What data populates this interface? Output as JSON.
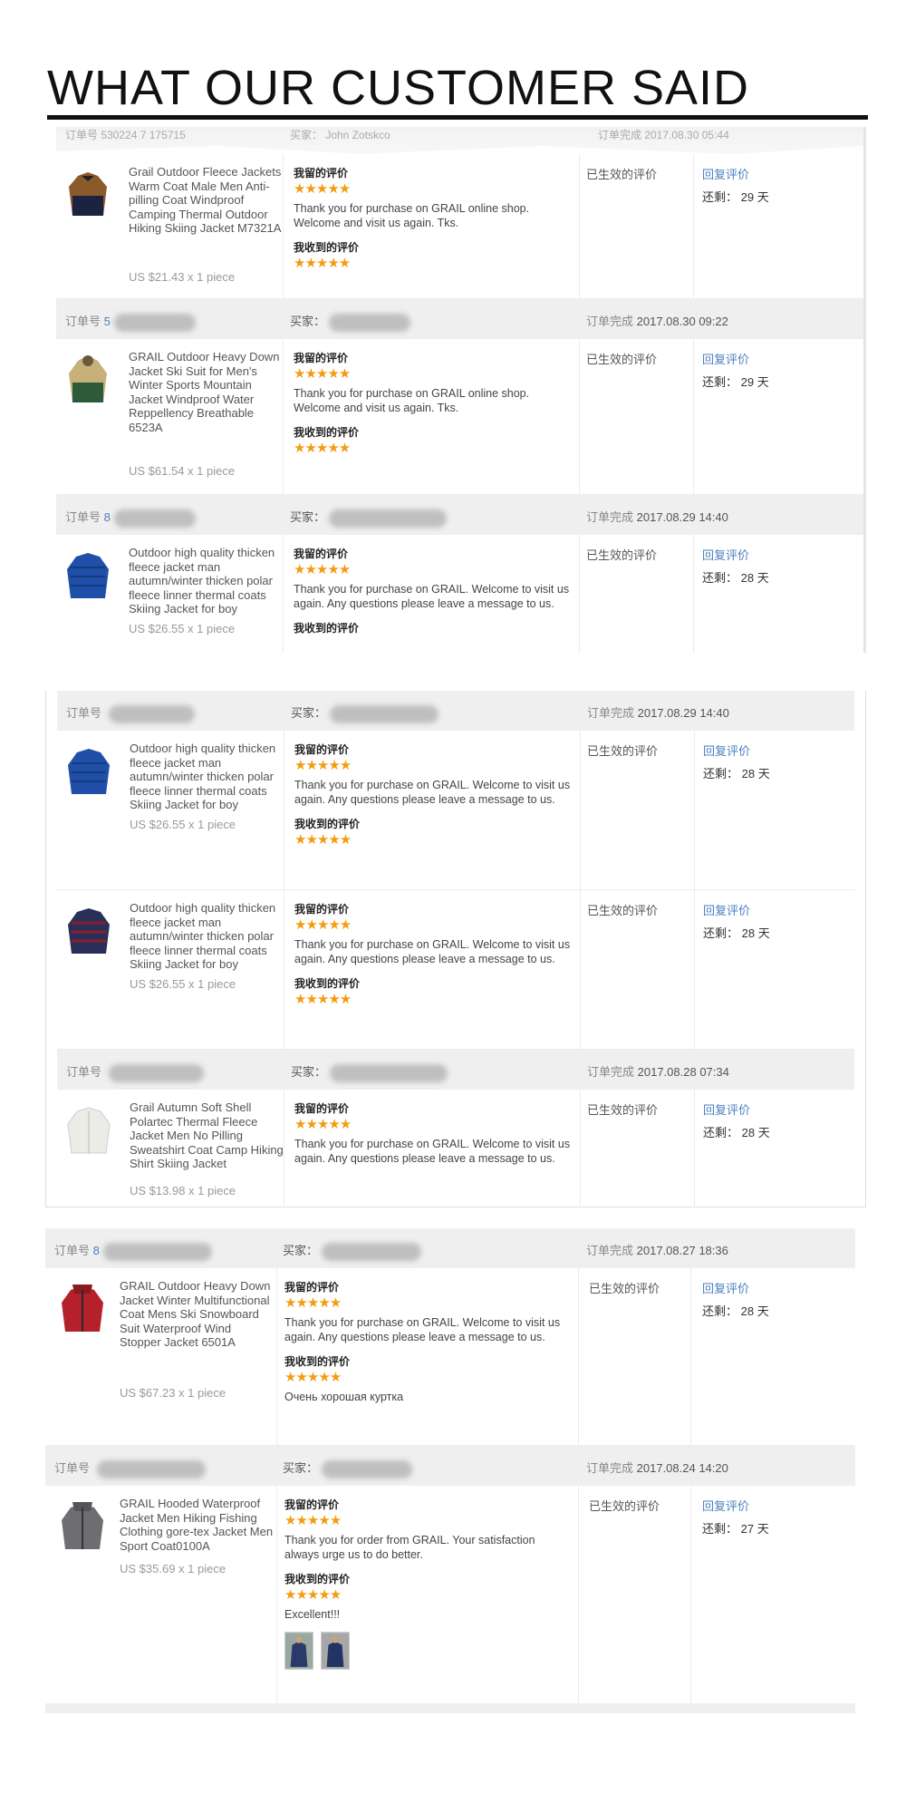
{
  "page_title": "WHAT OUR CUSTOMER SAID",
  "labels": {
    "order_no": "订单号",
    "buyer": "买家：",
    "order_done": "订单完成",
    "my_review": "我留的评价",
    "received_review": "我收到的评价",
    "effective": "已生效的评价",
    "reply": "回复评价",
    "remain_prefix": "还剩：",
    "days_suffix": "天"
  },
  "top_strip": {
    "order_no_partial": "订单号 530224 7 175715",
    "buyer_partial": "买家： John Zotskco",
    "done_partial": "订单完成 2017.08.30 05:44"
  },
  "orders": [
    {
      "done_time": "2017.08.30 09:22",
      "no_partial": "5"
    },
    {
      "done_time": "2017.08.29 14:40",
      "no_partial": "8"
    },
    {
      "done_time": "2017.08.29 14:40",
      "no_partial": ""
    },
    {
      "done_time": "2017.08.28 07:34",
      "no_partial": ""
    },
    {
      "done_time": "2017.08.27 18:36",
      "no_partial": "8"
    },
    {
      "done_time": "2017.08.24 14:20",
      "no_partial": ""
    }
  ],
  "items": [
    {
      "name": "Grail Outdoor Fleece Jackets Warm Coat Male Men Anti-pilling Coat Windproof Camping Thermal Outdoor Hiking Skiing Jacket M7321A",
      "price": "US $21.43 x 1 piece",
      "feedback": "Thank you for purchase on GRAIL online shop. Welcome and visit us again. Tks.",
      "days": "29",
      "received_text": ""
    },
    {
      "name": "GRAIL Outdoor Heavy Down Jacket Ski Suit for Men's Winter Sports Mountain Jacket Windproof Water Reppellency Breathable 6523A",
      "price": "US $61.54 x 1 piece",
      "feedback": "Thank you for purchase on GRAIL online shop. Welcome and visit us again. Tks.",
      "days": "29",
      "received_text": ""
    },
    {
      "name": "Outdoor high quality thicken fleece jacket man autumn/winter thicken polar fleece linner thermal coats Skiing Jacket for boy",
      "price": "US $26.55 x 1 piece",
      "feedback": "Thank you for purchase on GRAIL. Welcome to visit us again. Any questions please leave a message to us.",
      "days": "28",
      "received_text": ""
    },
    {
      "name": "Outdoor high quality thicken fleece jacket man autumn/winter thicken polar fleece linner thermal coats Skiing Jacket for boy",
      "price": "US $26.55 x 1 piece",
      "feedback": "Thank you for purchase on GRAIL. Welcome to visit us again. Any questions please leave a message to us.",
      "days": "28",
      "received_text": ""
    },
    {
      "name": "Outdoor high quality thicken fleece jacket man autumn/winter thicken polar fleece linner thermal coats Skiing Jacket for boy",
      "price": "US $26.55 x 1 piece",
      "feedback": "Thank you for purchase on GRAIL. Welcome to visit us again. Any questions please leave a message to us.",
      "days": "28",
      "received_text": ""
    },
    {
      "name": "Grail Autumn Soft Shell Polartec Thermal Fleece Jacket Men No Pilling Sweatshirt Coat Camp Hiking Shirt Skiing Jacket",
      "price": "US $13.98 x 1 piece",
      "feedback": "Thank you for purchase on GRAIL. Welcome to visit us again. Any questions please leave a message to us.",
      "days": "28",
      "received_text": ""
    },
    {
      "name": "GRAIL Outdoor Heavy Down Jacket Winter Multifunctional Coat Mens Ski Snowboard Suit Waterproof Wind Stopper Jacket 6501A",
      "price": "US $67.23 x 1 piece",
      "feedback": "Thank you for purchase on GRAIL. Welcome to visit us again. Any questions please leave a message to us.",
      "days": "28",
      "received_text": "Очень хорошая куртка"
    },
    {
      "name": "GRAIL Hooded Waterproof Jacket Men Hiking Fishing Clothing gore-tex Jacket Men Sport Coat0100A",
      "price": "US $35.69 x 1 piece",
      "feedback": "Thank you for order from GRAIL. Your satisfaction always urge us to do better.",
      "days": "27",
      "received_text": "Excellent!!!"
    }
  ],
  "stars": "★★★★★",
  "colors": {
    "link": "#4a7fbf",
    "star": "#f39c12",
    "header_bg": "#efefef"
  }
}
